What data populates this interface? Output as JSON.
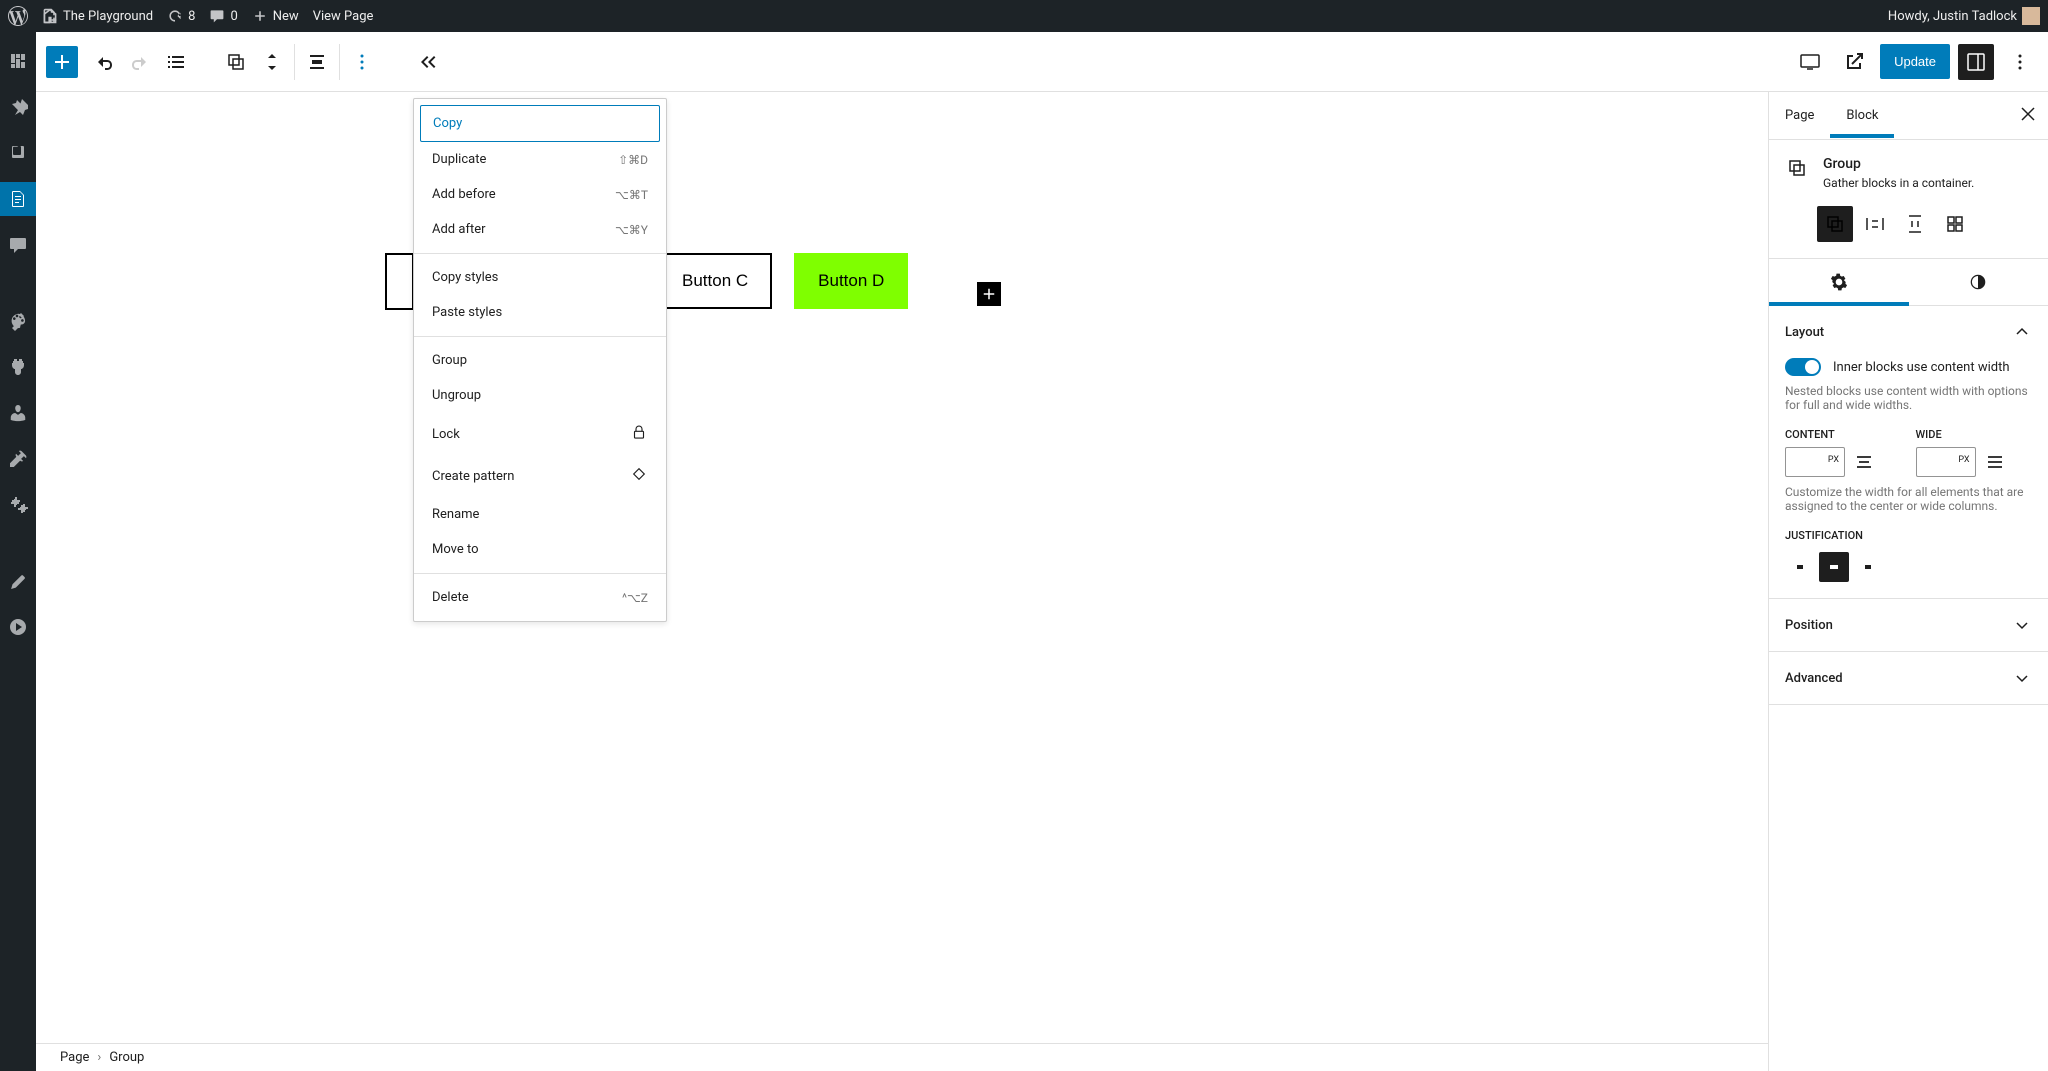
{
  "admin_bar": {
    "site_name": "The Playground",
    "updates_count": "8",
    "comments_count": "0",
    "new_label": "New",
    "view_page_label": "View Page",
    "howdy": "Howdy, Justin Tadlock"
  },
  "toolbar": {
    "update_label": "Update"
  },
  "context_menu": {
    "copy": "Copy",
    "duplicate": "Duplicate",
    "duplicate_shortcut": "⇧⌘D",
    "add_before": "Add before",
    "add_before_shortcut": "⌥⌘T",
    "add_after": "Add after",
    "add_after_shortcut": "⌥⌘Y",
    "copy_styles": "Copy styles",
    "paste_styles": "Paste styles",
    "group": "Group",
    "ungroup": "Ungroup",
    "lock": "Lock",
    "create_pattern": "Create pattern",
    "rename": "Rename",
    "move_to": "Move to",
    "delete": "Delete",
    "delete_shortcut": "^⌥Z"
  },
  "buttons": {
    "c": "Button C",
    "d": "Button D"
  },
  "sidebar": {
    "tabs": {
      "page": "Page",
      "block": "Block"
    },
    "block_title": "Group",
    "block_desc": "Gather blocks in a container.",
    "layout": {
      "title": "Layout",
      "toggle_label": "Inner blocks use content width",
      "help": "Nested blocks use content width with options for full and wide widths.",
      "content_label": "CONTENT",
      "wide_label": "WIDE",
      "unit": "PX",
      "customize_help": "Customize the width for all elements that are assigned to the center or wide columns.",
      "justification_label": "JUSTIFICATION"
    },
    "position_title": "Position",
    "advanced_title": "Advanced"
  },
  "footer": {
    "crumb1": "Page",
    "crumb2": "Group"
  }
}
